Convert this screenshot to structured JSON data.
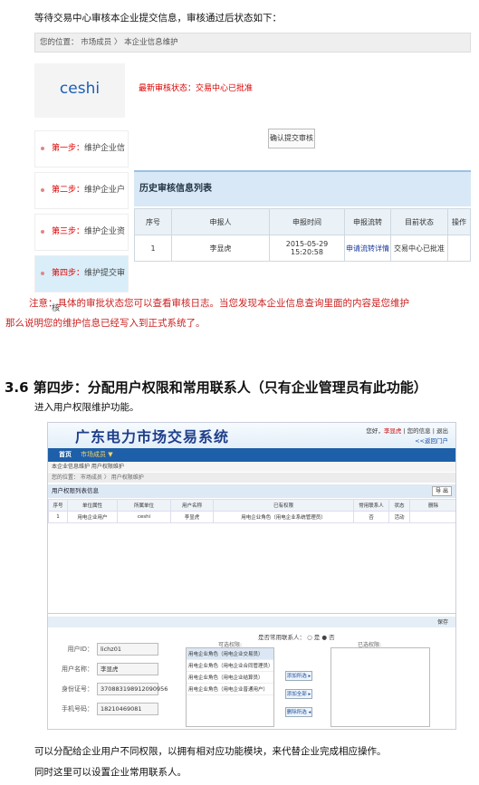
{
  "intro": "等待交易中心审核本企业提交信息，审核通过后状态如下：",
  "shot1": {
    "breadcrumb": "您的位置：  市场成员 〉 本企业信息维护",
    "logo": "ceshi",
    "status": "最新审核状态：交易中心已批准",
    "steps": [
      {
        "num": "第一步：",
        "label": "维护企业信息"
      },
      {
        "num": "第二步：",
        "label": "维护企业户号"
      },
      {
        "num": "第三步：",
        "label": "维护企业资质"
      },
      {
        "num": "第四步：",
        "label": "维护提交审核"
      }
    ],
    "confirm_button": "确认提交审核",
    "history_title": "历史审核信息列表",
    "history_headers": [
      "序号",
      "申报人",
      "申报时间",
      "申报流转",
      "目前状态",
      "操作"
    ],
    "history_row": [
      "1",
      "李显虎",
      "2015-05-29 15:20:58",
      "申请流转详情",
      "交易中心已批准",
      ""
    ]
  },
  "note_line1": "注意：具体的审批状态您可以查看审核日志。当您发现本企业信息查询里面的内容是您维护",
  "note_line2": "那么说明您的维护信息已经写入到正式系统了。",
  "section_title": "3.6  第四步：分配用户权限和常用联系人（只有企业管理员有此功能）",
  "intro2": "进入用户权限维护功能。",
  "shot2": {
    "banner_title": "广东电力市场交易系统",
    "banner_right_prefix": "您好，",
    "banner_user": "李显虎",
    "banner_links": " | 您的信息 | 退出",
    "back": "<<返回门户",
    "nav_home": "首页",
    "nav_member": "市场成员 ▼",
    "sub_tabs": "本企业信息维护    用户权限维护",
    "breadcrumb": "您的位置：  市场成员 〉 用户权限维护",
    "list_title": "用户权限列表信息",
    "export": "导 出",
    "table_headers": [
      "序号",
      "单位属性",
      "所属单位",
      "用户名称",
      "已有权限",
      "常用联系人",
      "状态",
      "删除"
    ],
    "table_row": [
      "1",
      "用电企业用户",
      "ceshi",
      "李显虎",
      "用电企业角色（用电企业系统管理员）",
      "否",
      "活动",
      ""
    ],
    "save": "保存",
    "form": [
      {
        "label": "用户ID：",
        "value": "lichz01"
      },
      {
        "label": "用户名称：",
        "value": "李显虎"
      },
      {
        "label": "身份证号：",
        "value": "370883198912090956"
      },
      {
        "label": "手机号码：",
        "value": "18210469081"
      }
    ],
    "contact_q": "是否常用联系人：  ○ 是  ● 否",
    "available_label": "可选权限:",
    "selected_label": "已选权限:",
    "options": [
      "用电企业角色（用电企业交易员）",
      "用电企业角色（用电企业合同管理员）",
      "用电企业角色（用电企业结算员）",
      "用电企业角色（用电企业普通用户）"
    ],
    "buttons": [
      "添加所选 ▸",
      "添加全部 ▸",
      "删除所选 ◂"
    ]
  },
  "outro1": "可以分配给企业用户不同权限，以拥有相对应功能模块，来代替企业完成相应操作。",
  "outro2": "同时这里可以设置企业常用联系人。"
}
